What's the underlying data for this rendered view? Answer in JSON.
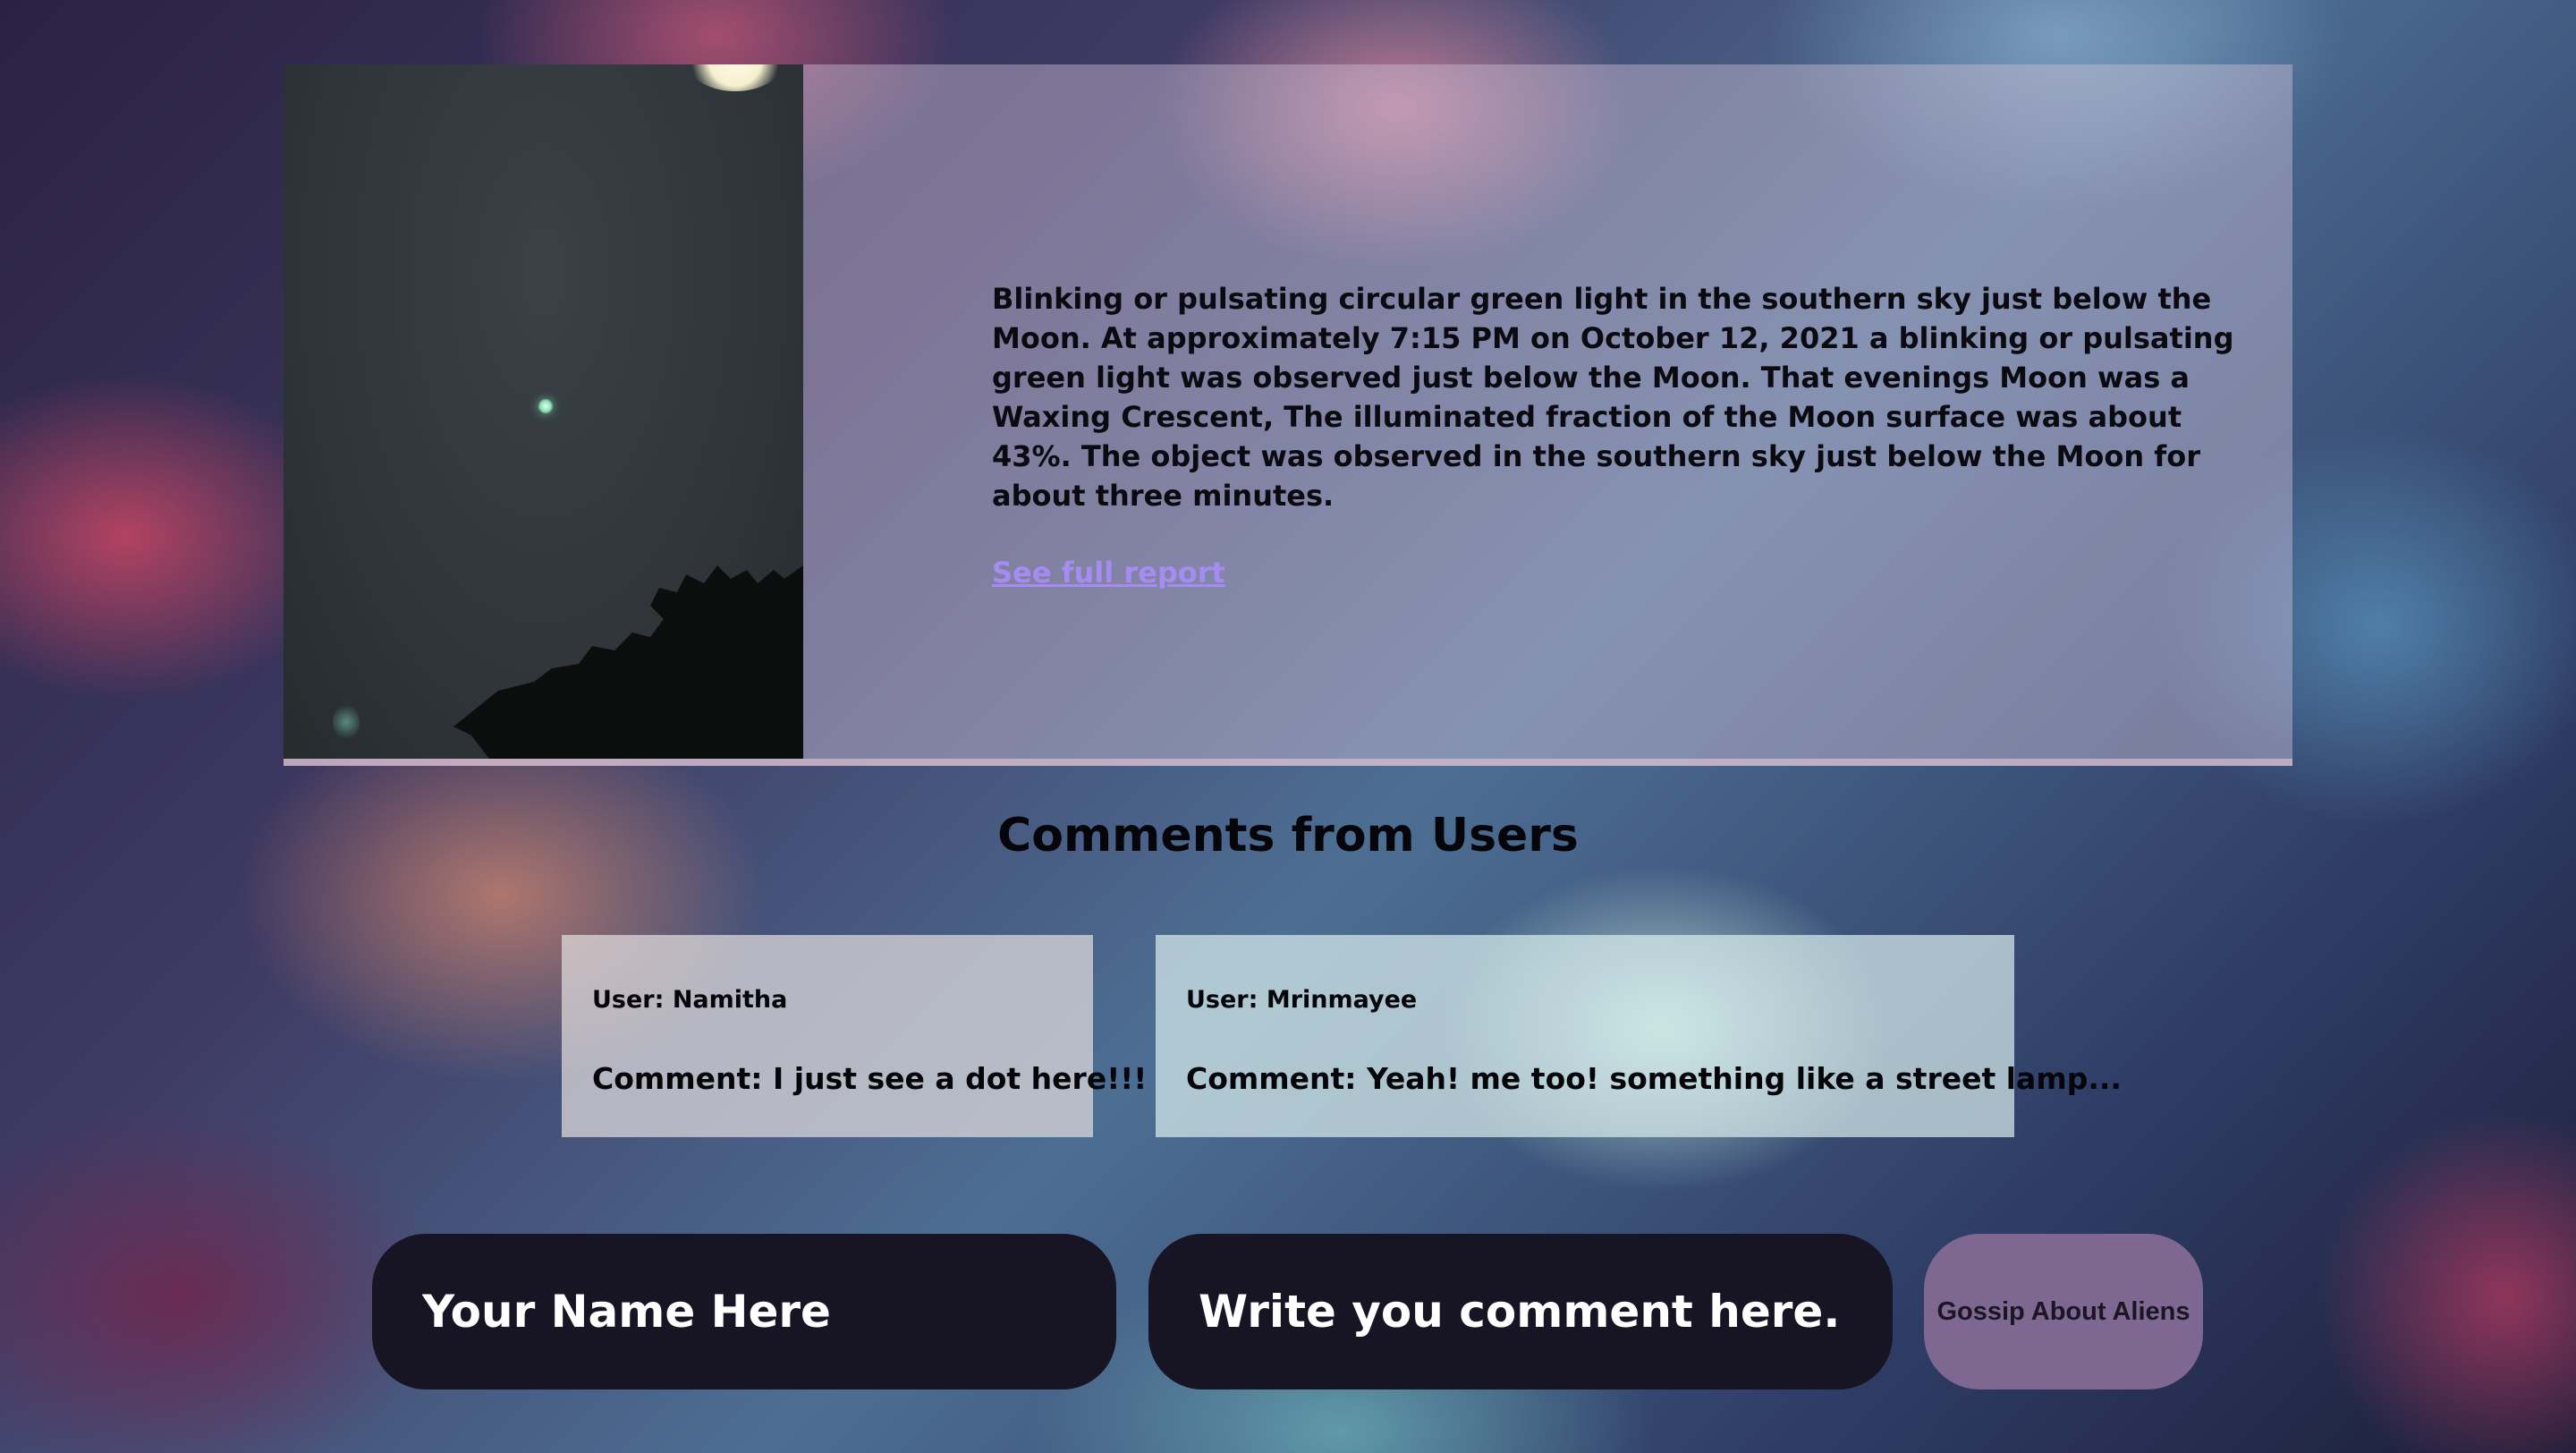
{
  "report": {
    "description": "Blinking or pulsating circular green light in the southern sky just below the Moon. At approximately 7:15 PM on October 12, 2021 a blinking or pulsating green light was observed just below the Moon. That evenings Moon was a Waxing Crescent, The illuminated fraction of the Moon surface was about 43%. The object was observed in the southern sky just below the Moon for about three minutes.",
    "link_label": "See full report"
  },
  "comments_section": {
    "heading": "Comments from Users",
    "items": [
      {
        "user": "User: Namitha",
        "comment": "Comment: I just see a dot here!!!"
      },
      {
        "user": "User: Mrinmayee",
        "comment": "Comment: Yeah! me too! something like a street lamp..."
      }
    ]
  },
  "form": {
    "name_placeholder": "Your Name Here",
    "comment_placeholder": "Write you comment here..",
    "submit_label": "Gossip About Aliens"
  },
  "colors": {
    "link": "#a58cf2",
    "input_bg": "#171424",
    "button_bg": "#7e6790"
  }
}
